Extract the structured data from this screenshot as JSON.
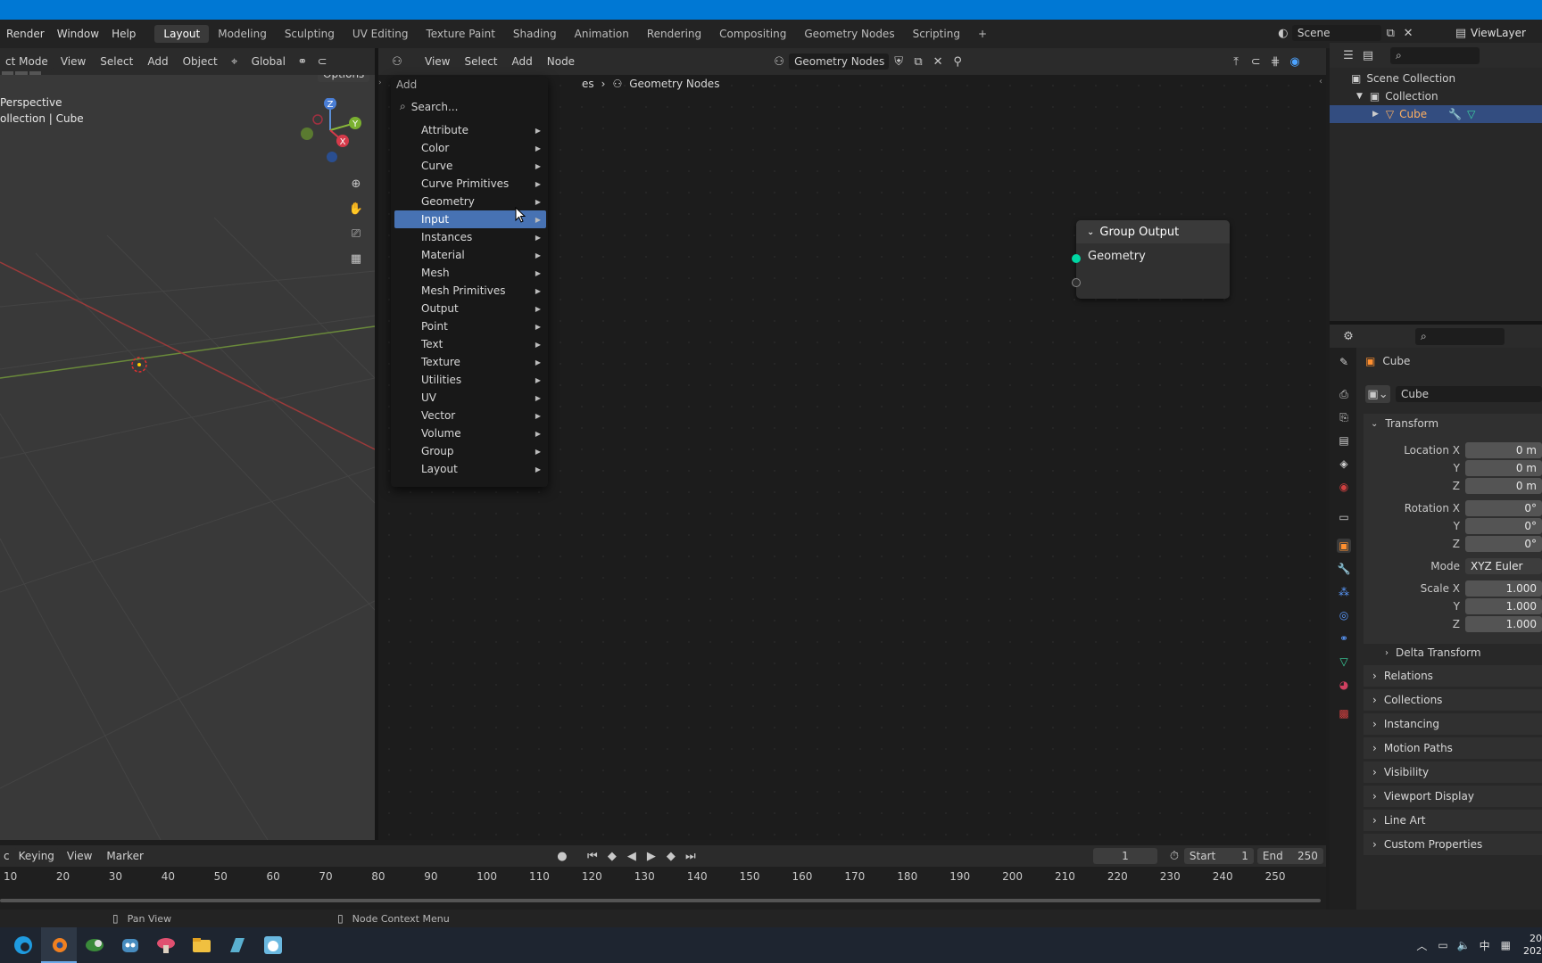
{
  "topbar": {
    "menus": [
      "Render",
      "Window",
      "Help"
    ],
    "workspaces": [
      "Layout",
      "Modeling",
      "Sculpting",
      "UV Editing",
      "Texture Paint",
      "Shading",
      "Animation",
      "Rendering",
      "Compositing",
      "Geometry Nodes",
      "Scripting"
    ],
    "active_workspace": "Layout",
    "add_workspace": "+",
    "scene": "Scene",
    "view_layer": "ViewLayer"
  },
  "viewport_header": {
    "mode": "ct Mode",
    "view": "View",
    "select": "Select",
    "add": "Add",
    "object": "Object",
    "transform": "Global",
    "options": "Options"
  },
  "viewport": {
    "line1": "Perspective",
    "line2": "ollection | Cube",
    "axes": {
      "z": "Z",
      "y": "Y",
      "x": "X"
    }
  },
  "node_header": {
    "view": "View",
    "select": "Select",
    "add": "Add",
    "node": "Node",
    "tree_name": "Geometry Nodes"
  },
  "breadcrumb": {
    "partial": "es",
    "current": "Geometry Nodes"
  },
  "node": {
    "title": "Group Output",
    "socket": "Geometry"
  },
  "add_menu": {
    "title": "Add",
    "search_placeholder": "Search...",
    "highlighted": "Input",
    "items": [
      "Attribute",
      "Color",
      "Curve",
      "Curve Primitives",
      "Geometry",
      "Input",
      "Instances",
      "Material",
      "Mesh",
      "Mesh Primitives",
      "Output",
      "Point",
      "Text",
      "Texture",
      "Utilities",
      "UV",
      "Vector",
      "Volume",
      "Group",
      "Layout"
    ]
  },
  "timeline": {
    "keying": "Keying",
    "view": "View",
    "marker": "Marker",
    "current_frame": "1",
    "start_label": "Start",
    "start": "1",
    "end_label": "End",
    "end": "250",
    "ticks": [
      "10",
      "20",
      "30",
      "40",
      "50",
      "60",
      "70",
      "80",
      "90",
      "100",
      "110",
      "120",
      "130",
      "140",
      "150",
      "160",
      "170",
      "180",
      "190",
      "200",
      "210",
      "220",
      "230",
      "240",
      "250"
    ]
  },
  "outliner": {
    "scene_collection": "Scene Collection",
    "collection": "Collection",
    "object": "Cube"
  },
  "properties": {
    "object_name": "Cube",
    "data_name": "Cube",
    "transform": "Transform",
    "location_x_label": "Location X",
    "location_x": "0 m",
    "location_y": "0 m",
    "location_z": "0 m",
    "rotation_x_label": "Rotation X",
    "rotation_x": "0°",
    "rotation_y": "0°",
    "rotation_z": "0°",
    "mode_label": "Mode",
    "mode": "XYZ Euler",
    "scale_x_label": "Scale X",
    "scale_x": "1.000",
    "scale_y": "1.000",
    "scale_z": "1.000",
    "y_label": "Y",
    "z_label": "Z",
    "delta_transform": "Delta Transform",
    "panels": [
      "Relations",
      "Collections",
      "Instancing",
      "Motion Paths",
      "Visibility",
      "Viewport Display",
      "Line Art",
      "Custom Properties"
    ]
  },
  "statusbar": {
    "pan_view": "Pan View",
    "context_menu": "Node Context Menu"
  },
  "taskbar": {
    "ime": "中",
    "clock_time": "20",
    "clock_date": "202"
  },
  "colors": {
    "accent": "#4772b3",
    "socket_geometry": "#00d6a3",
    "titlebar": "#0078d4"
  }
}
